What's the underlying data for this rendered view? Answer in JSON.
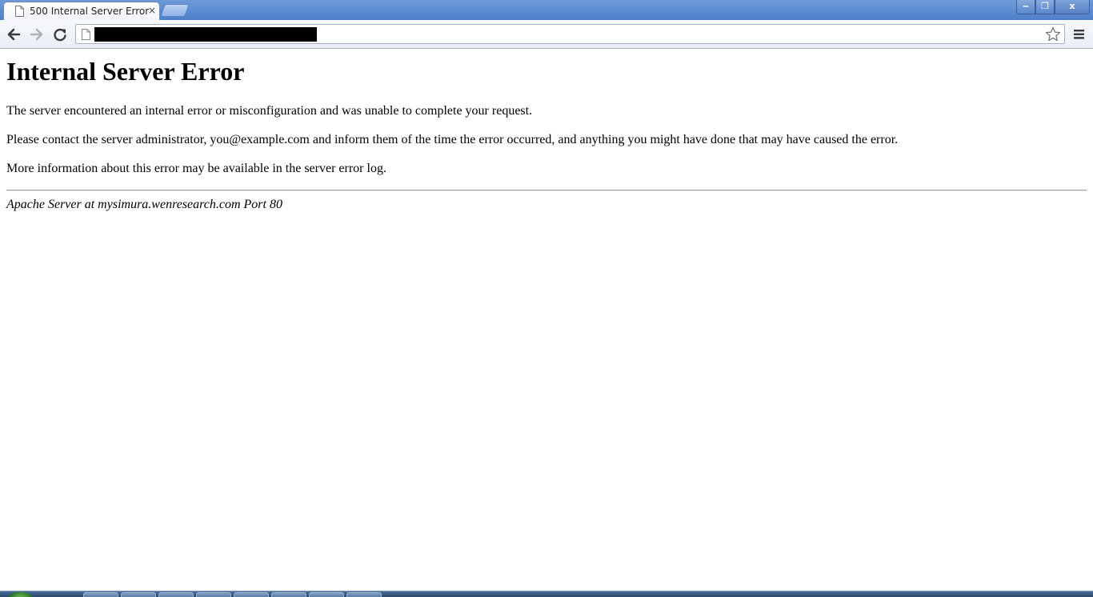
{
  "browser": {
    "tab": {
      "title": "500 Internal Server Error",
      "close_glyph": "×",
      "favicon": "page-icon"
    },
    "window_controls": {
      "minimize": "‒",
      "maximize": "❐",
      "close": "x"
    },
    "toolbar": {
      "back_icon": "arrow-left-icon",
      "forward_icon": "arrow-right-icon",
      "reload_icon": "reload-icon",
      "url": "",
      "star_icon": "star-icon",
      "menu_icon": "hamburger-menu-icon"
    }
  },
  "page": {
    "heading": "Internal Server Error",
    "paragraphs": [
      "The server encountered an internal error or misconfiguration and was unable to complete your request.",
      "Please contact the server administrator, you@example.com and inform them of the time the error occurred, and anything you might have done that may have caused the error.",
      "More information about this error may be available in the server error log."
    ],
    "server_signature": "Apache Server at mysimura.wenresearch.com Port 80"
  },
  "colors": {
    "titlebar": "#5a87cc",
    "toolbar": "#eef2f8",
    "page_background": "#ffffff",
    "text": "#000000",
    "redacted_url": "#000000"
  }
}
